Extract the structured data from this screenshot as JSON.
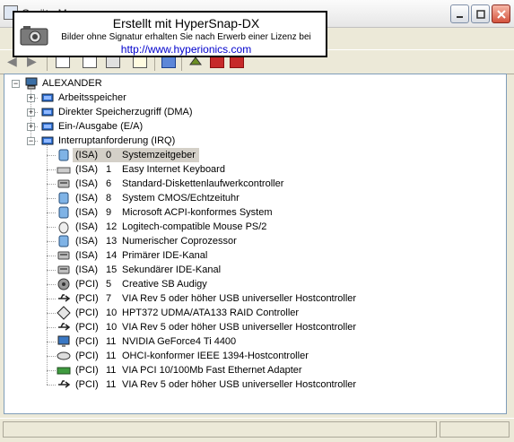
{
  "window": {
    "title": "Geräte-Manager"
  },
  "banner": {
    "line1": "Erstellt mit HyperSnap-DX",
    "line2": "Bilder ohne Signatur erhalten Sie nach Erwerb einer Lizenz bei",
    "line3": "http://www.hyperionics.com"
  },
  "tree": {
    "root": "ALEXANDER",
    "categories": [
      {
        "label": "Arbeitsspeicher",
        "expanded": false
      },
      {
        "label": "Direkter Speicherzugriff (DMA)",
        "expanded": false
      },
      {
        "label": "Ein-/Ausgabe (E/A)",
        "expanded": false
      },
      {
        "label": "Interruptanforderung (IRQ)",
        "expanded": true
      }
    ],
    "irq": [
      {
        "bus": "(ISA)",
        "num": "0",
        "name": "Systemzeitgeber",
        "icon": "system-device-icon",
        "selected": true
      },
      {
        "bus": "(ISA)",
        "num": "1",
        "name": "Easy Internet Keyboard",
        "icon": "keyboard-icon",
        "selected": false
      },
      {
        "bus": "(ISA)",
        "num": "6",
        "name": "Standard-Diskettenlaufwerkcontroller",
        "icon": "floppy-controller-icon",
        "selected": false
      },
      {
        "bus": "(ISA)",
        "num": "8",
        "name": "System CMOS/Echtzeituhr",
        "icon": "system-device-icon",
        "selected": false
      },
      {
        "bus": "(ISA)",
        "num": "9",
        "name": "Microsoft ACPI-konformes System",
        "icon": "system-device-icon",
        "selected": false
      },
      {
        "bus": "(ISA)",
        "num": "12",
        "name": "Logitech-compatible Mouse PS/2",
        "icon": "mouse-icon",
        "selected": false
      },
      {
        "bus": "(ISA)",
        "num": "13",
        "name": "Numerischer Coprozessor",
        "icon": "system-device-icon",
        "selected": false
      },
      {
        "bus": "(ISA)",
        "num": "14",
        "name": "Primärer IDE-Kanal",
        "icon": "ide-controller-icon",
        "selected": false
      },
      {
        "bus": "(ISA)",
        "num": "15",
        "name": "Sekundärer IDE-Kanal",
        "icon": "ide-controller-icon",
        "selected": false
      },
      {
        "bus": "(PCI)",
        "num": "5",
        "name": "Creative SB Audigy",
        "icon": "sound-card-icon",
        "selected": false
      },
      {
        "bus": "(PCI)",
        "num": "7",
        "name": "VIA Rev 5 oder höher USB universeller Hostcontroller",
        "icon": "usb-icon",
        "selected": false
      },
      {
        "bus": "(PCI)",
        "num": "10",
        "name": "HPT372 UDMA/ATA133 RAID Controller",
        "icon": "scsi-raid-icon",
        "selected": false
      },
      {
        "bus": "(PCI)",
        "num": "10",
        "name": "VIA Rev 5 oder höher USB universeller Hostcontroller",
        "icon": "usb-icon",
        "selected": false
      },
      {
        "bus": "(PCI)",
        "num": "11",
        "name": "NVIDIA GeForce4 Ti 4400",
        "icon": "display-adapter-icon",
        "selected": false
      },
      {
        "bus": "(PCI)",
        "num": "11",
        "name": "OHCI-konformer IEEE 1394-Hostcontroller",
        "icon": "firewire-icon",
        "selected": false
      },
      {
        "bus": "(PCI)",
        "num": "11",
        "name": "VIA PCI 10/100Mb Fast Ethernet Adapter",
        "icon": "network-adapter-icon",
        "selected": false
      },
      {
        "bus": "(PCI)",
        "num": "11",
        "name": "VIA Rev 5 oder höher USB universeller Hostcontroller",
        "icon": "usb-icon",
        "selected": false
      }
    ]
  },
  "colors": {
    "selection": "#d4d0c8",
    "banner_link": "#0000cc"
  }
}
